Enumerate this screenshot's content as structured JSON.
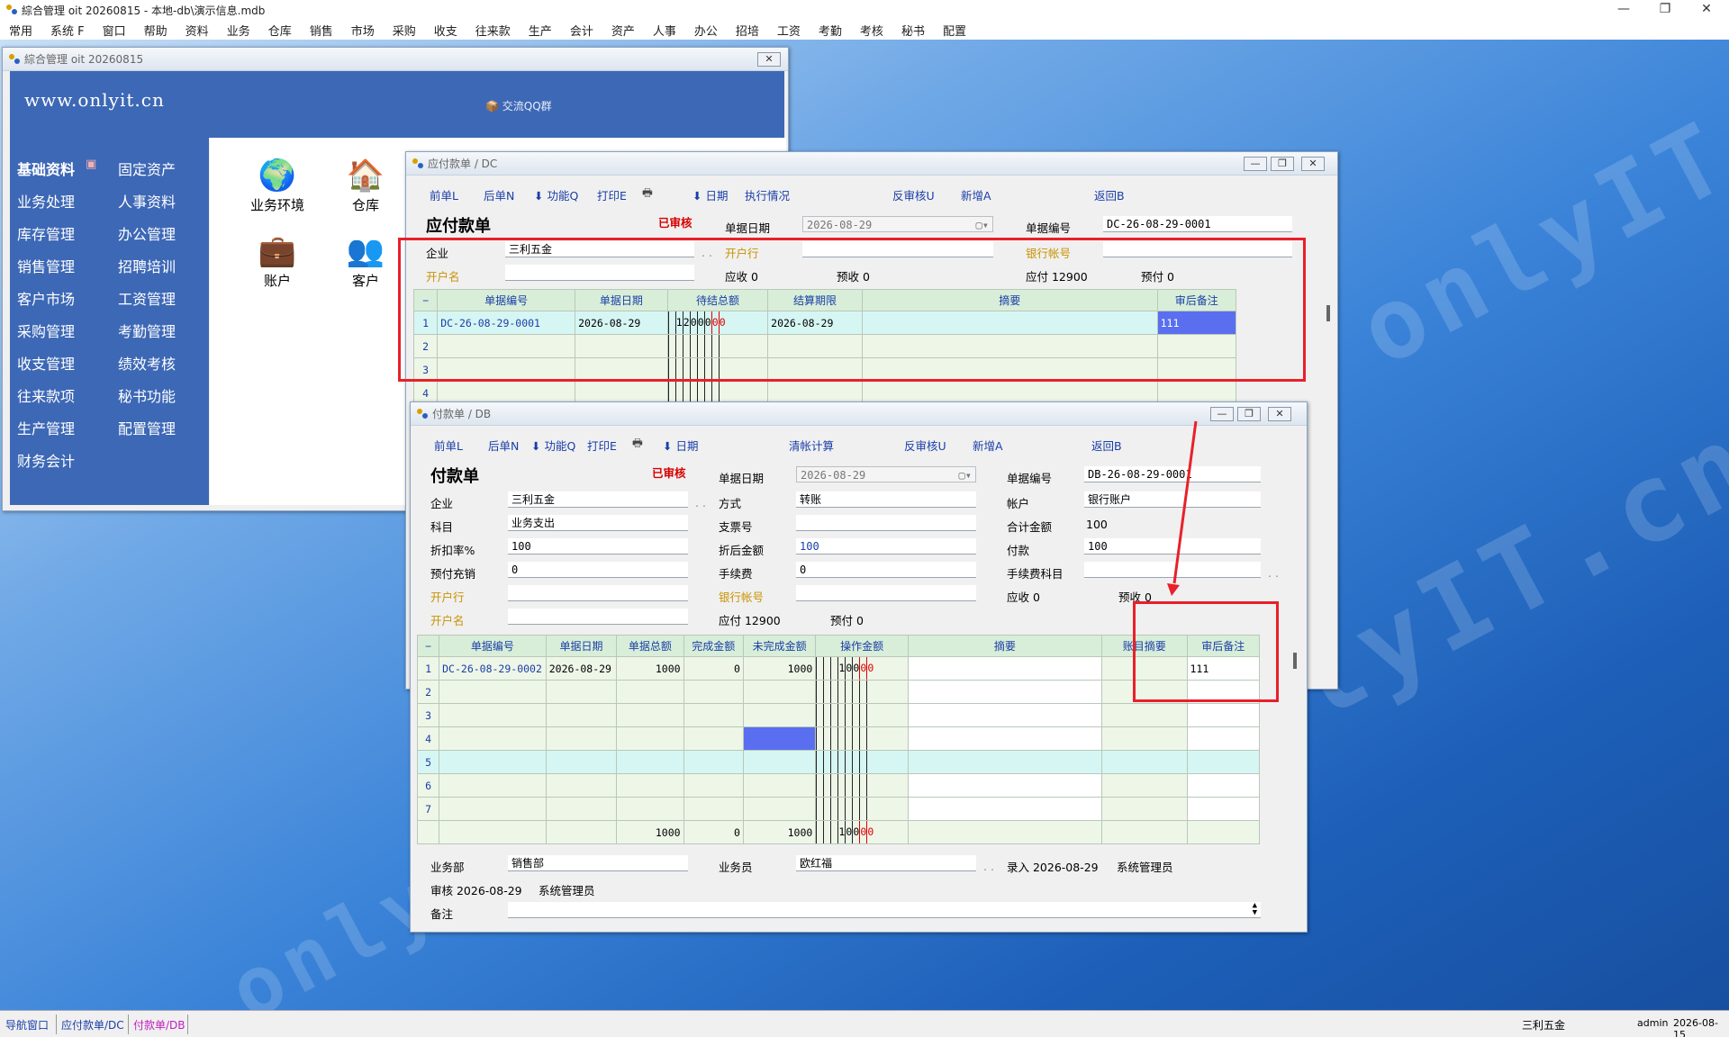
{
  "app": {
    "title": "綜合管理 oit 20260815 - 本地-db\\演示信息.mdb"
  },
  "menu": [
    "常用",
    "系统 F",
    "窗口",
    "帮助",
    "资料",
    "业务",
    "仓库",
    "销售",
    "市场",
    "采购",
    "收支",
    "往来款",
    "生产",
    "会计",
    "资产",
    "人事",
    "办公",
    "招培",
    "工资",
    "考勤",
    "考核",
    "秘书",
    "配置"
  ],
  "navwin": {
    "title": "綜合管理 oit 20260815",
    "url": "www.onlyit.cn",
    "qq": "交流QQ群",
    "left": [
      "基础资料",
      "业务处理",
      "库存管理",
      "销售管理",
      "客户市场",
      "采购管理",
      "收支管理",
      "往来款项",
      "生产管理",
      "财务会计"
    ],
    "right": [
      "固定资产",
      "人事资料",
      "办公管理",
      "招聘培训",
      "工资管理",
      "考勤管理",
      "绩效考核",
      "秘书功能",
      "配置管理"
    ],
    "icons": [
      "业务环境",
      "仓库",
      "账户",
      "客户"
    ],
    "icon_glyphs": [
      "globe-icon",
      "house-icon",
      "briefcase-icon",
      "people-icon"
    ]
  },
  "watermark": "onlyIT.cn",
  "ap": {
    "title": "应付款单 / DC",
    "toolbar": [
      "前单L",
      "后单N",
      "功能Q",
      "打印E",
      "日期",
      "执行情况",
      "反审核U",
      "新增A",
      "返回B"
    ],
    "heading": "应付款单",
    "status": "已审核",
    "date_label": "单据日期",
    "date": "2026-08-29",
    "no_label": "单据编号",
    "no": "DC-26-08-29-0001",
    "company_label": "企业",
    "company": "三利五金",
    "bank_label": "开户行",
    "account_label": "银行帐号",
    "acctname_label": "开户名",
    "receivable": "应收 0",
    "prerecv": "预收 0",
    "payable": "应付 12900",
    "prepay": "预付 0",
    "cols": [
      "单据编号",
      "单据日期",
      "待结总额",
      "结算期限",
      "摘要",
      "审后备注"
    ],
    "rows": [
      {
        "n": "1",
        "no": "DC-26-08-29-0001",
        "date": "2026-08-29",
        "amount": "1200000",
        "due": "2026-08-29",
        "memo": "",
        "note": "111"
      },
      {
        "n": "2"
      },
      {
        "n": "3"
      },
      {
        "n": "4"
      }
    ]
  },
  "pay": {
    "title": "付款单 / DB",
    "toolbar": [
      "前单L",
      "后单N",
      "功能Q",
      "打印E",
      "日期",
      "清帐计算",
      "反审核U",
      "新增A",
      "返回B"
    ],
    "heading": "付款单",
    "status": "已审核",
    "date_label": "单据日期",
    "date": "2026-08-29",
    "no_label": "单据编号",
    "no": "DB-26-08-29-0001",
    "company_label": "企业",
    "company": "三利五金",
    "method_label": "方式",
    "method": "转账",
    "account_label": "帐户",
    "account": "银行账户",
    "subject_label": "科目",
    "subject": "业务支出",
    "check_label": "支票号",
    "total_label": "合计金额",
    "total": "100",
    "discount_label": "折扣率%",
    "discount": "100",
    "disc_amt_label": "折后金额",
    "disc_amt": "100",
    "pay_label": "付款",
    "pay": "100",
    "prepay_label": "预付充销",
    "prepay": "0",
    "fee_label": "手续费",
    "fee": "0",
    "fee_subject_label": "手续费科目",
    "bank_label": "开户行",
    "bankacc_label": "银行帐号",
    "acctname_label": "开户名",
    "payable": "应付 12900",
    "prepay2": "预付 0",
    "receivable": "应收 0",
    "prerecv": "预收 0",
    "cols": [
      "单据编号",
      "单据日期",
      "单据总额",
      "完成金额",
      "未完成金额",
      "操作金额",
      "摘要",
      "账目摘要",
      "审后备注"
    ],
    "rows": [
      {
        "n": "1",
        "no": "DC-26-08-29-0002",
        "date": "2026-08-29",
        "total": "1000",
        "done": "0",
        "left": "1000",
        "op": "10000",
        "memo": "",
        "acct": "",
        "note": "111"
      },
      {
        "n": "2"
      },
      {
        "n": "3"
      },
      {
        "n": "4"
      },
      {
        "n": "5"
      },
      {
        "n": "6"
      },
      {
        "n": "7"
      }
    ],
    "sum": {
      "total": "1000",
      "done": "0",
      "left": "1000",
      "op": "10000"
    },
    "dept_label": "业务部",
    "dept": "销售部",
    "staff_label": "业务员",
    "staff": "欧红福",
    "entry": "录入 2026-08-29",
    "entry_user": "系统管理员",
    "audit": "审核 2026-08-29",
    "audit_user": "系统管理员",
    "remark_label": "备注"
  },
  "status": {
    "tabs": [
      "导航窗口",
      "应付款单/DC",
      "付款单/DB"
    ],
    "company": "三利五金",
    "user": "admin",
    "date": "2026-08-15"
  }
}
